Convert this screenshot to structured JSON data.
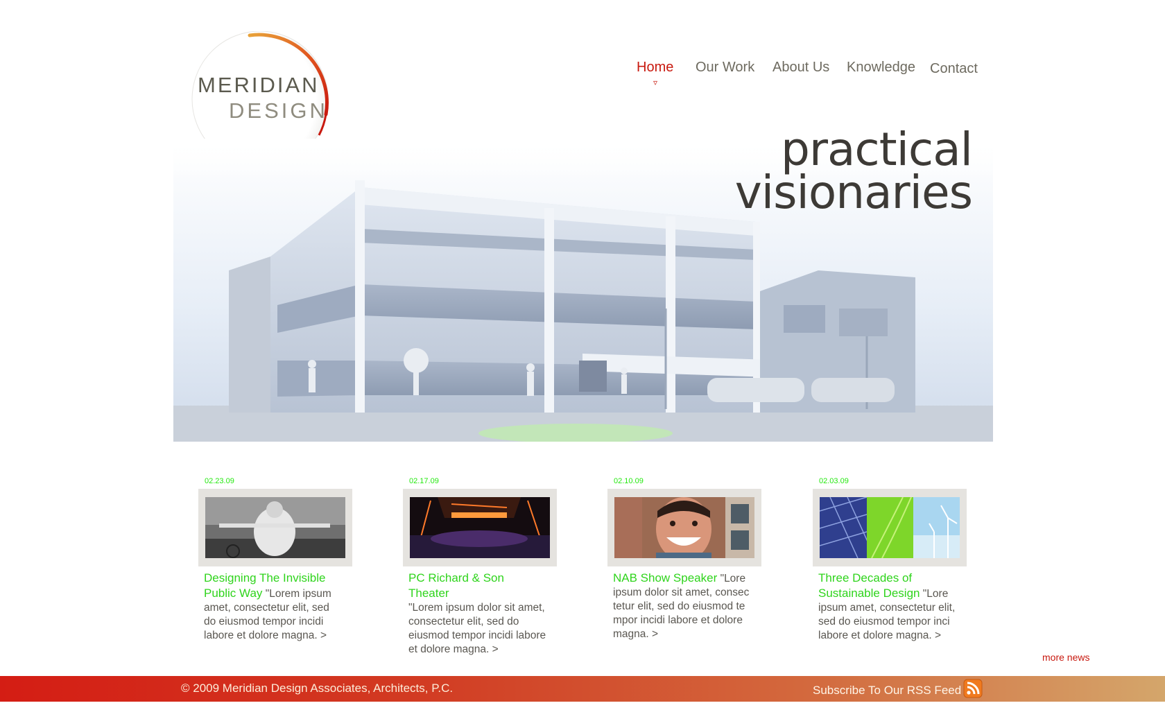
{
  "logo": {
    "line1": "MERIDIAN",
    "line2": "DESIGN"
  },
  "nav": {
    "items": [
      {
        "label": "Home",
        "active": true
      },
      {
        "label": "Our Work",
        "active": false
      },
      {
        "label": "About Us",
        "active": false
      },
      {
        "label": "Knowledge",
        "active": false
      },
      {
        "label": "Contact",
        "active": false
      }
    ],
    "active_marker": "▿"
  },
  "hero": {
    "tagline_line1": "practical",
    "tagline_line2": "visionaries"
  },
  "news": [
    {
      "date": "02.23.09",
      "title": "Designing The Invisible Public Way",
      "text": "\"Lorem ipsum amet, consectetur elit, sed do eiusmod tempor incidi labore et dolore magna.",
      "more": ">"
    },
    {
      "date": "02.17.09",
      "title": "PC Richard & Son Theater",
      "text": "\"Lorem ipsum dolor sit amet, consectetur elit, sed do eiusmod tempor incidi labore et dolore magna.",
      "more": ">"
    },
    {
      "date": "02.10.09",
      "title": "NAB Show Speaker",
      "text": "\"Lore ipsum dolor sit amet, consec tetur elit, sed do eiusmod te mpor incidi labore et dolore magna.",
      "more": ">"
    },
    {
      "date": "02.03.09",
      "title": "Three Decades of Sustainable Design",
      "text": "\"Lore ipsum amet, consectetur elit, sed do eiusmod tempor inci labore et dolore magna.",
      "more": ">"
    }
  ],
  "more_news": "more news",
  "footer": {
    "copyright": "© 2009 Meridian Design Associates, Architects, P.C.",
    "rss": "Subscribe To Our RSS Feed"
  },
  "colors": {
    "accent": "#c8190f",
    "news_green": "#2fd41c",
    "date_green": "#23e80e",
    "text": "#5a5751"
  }
}
